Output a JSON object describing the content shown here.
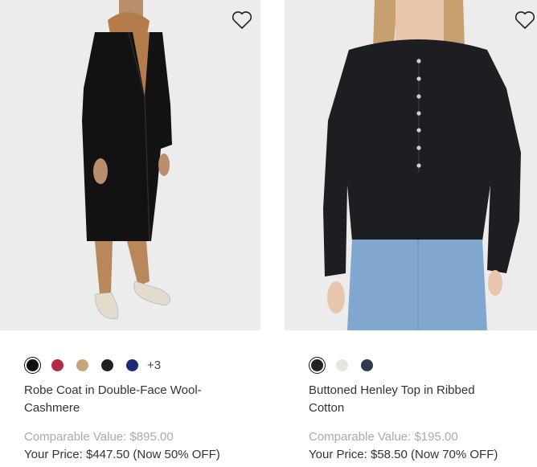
{
  "products": [
    {
      "name": "Robe Coat in Double-Face Wool-Cashmere",
      "swatches": [
        "#111111",
        "#b12c46",
        "#c9a47a",
        "#1e231e",
        "#1d2a7a"
      ],
      "more_colors": "+3",
      "comparable_value": "Comparable Value: $895.00",
      "your_price": "Your Price: $447.50 (Now 50% OFF)"
    },
    {
      "name": "Buttoned Henley Top in Ribbed Cotton",
      "swatches": [
        "#222326",
        "#e9e4dc",
        "#2f3a4e"
      ],
      "comparable_value": "Comparable Value: $195.00",
      "your_price": "Your Price: $58.50 (Now 70% OFF)"
    }
  ],
  "icons": {
    "wishlist": "heart-outline-icon"
  }
}
